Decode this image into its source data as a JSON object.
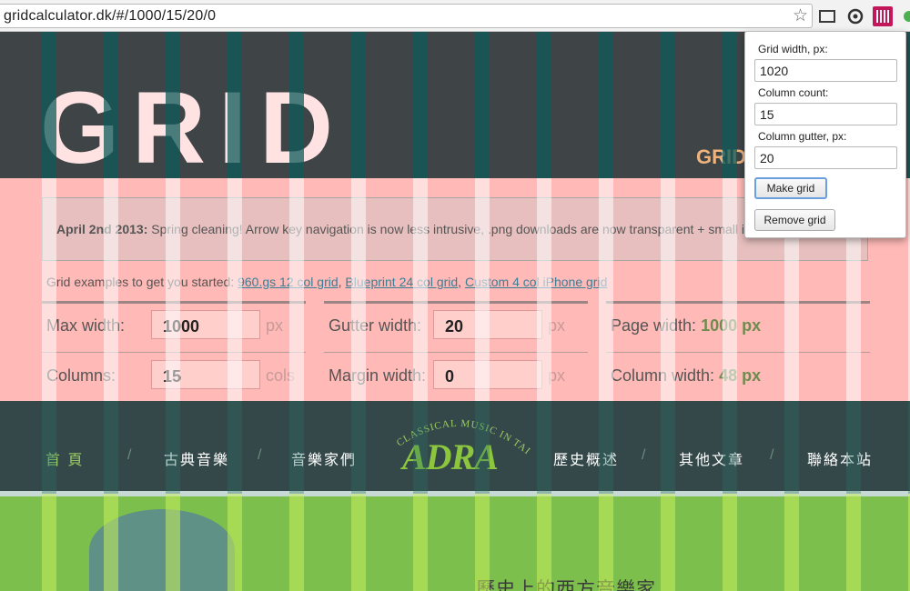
{
  "browser": {
    "url": "gridcalculator.dk/#/1000/15/20/0",
    "star_icon": "star-icon",
    "extension_icons": [
      "screenshot-icon",
      "sync-icon",
      "grid-extension-icon",
      "puzzle-icon"
    ]
  },
  "site": {
    "title": "GRID",
    "subtitle": "GRID",
    "notice_date": "April 2nd 2013:",
    "notice_text": " Spring cleaning! Arrow key navigation is now less intrusive, .png downloads are now transparent + small i",
    "examples_prefix": "Grid examples to get you started: ",
    "examples": [
      "960.gs 12 col grid",
      "Blueprint 24 col grid",
      "Custom 4 col iPhone grid"
    ],
    "fields": {
      "max_width_label": "Max width:",
      "max_width_value": "1000",
      "max_width_unit": "px",
      "columns_label": "Columns:",
      "columns_value": "15",
      "columns_unit": "cols",
      "gutter_label": "Gutter width:",
      "gutter_value": "20",
      "gutter_unit": "px",
      "margin_label": "Margin width:",
      "margin_value": "0",
      "margin_unit": "px",
      "page_width_label": "Page width: ",
      "page_width_value": "1000 px",
      "column_width_label": "Column width: ",
      "column_width_value": "48 px"
    }
  },
  "nav": {
    "items": [
      "首 頁",
      "古典音樂",
      "音樂家們",
      "歷史概述",
      "其他文章",
      "聯絡本站"
    ],
    "separator": "/",
    "logo_arc": "CLASSICAL MUSIC IN TAIWAN",
    "logo": "ADRA"
  },
  "main": {
    "headline": "歷史上的西方音樂家"
  },
  "popup": {
    "grid_width_label": "Grid width, px:",
    "grid_width_value": "1020",
    "column_count_label": "Column count:",
    "column_count_value": "15",
    "column_gutter_label": "Column gutter, px:",
    "column_gutter_value": "20",
    "make_grid": "Make grid",
    "remove_grid": "Remove grid"
  },
  "colors": {
    "header_bg": "#3f4446",
    "content_bg": "#ffb9b6",
    "nav_bg": "#34484a",
    "green_bg": "#7cbf4d",
    "accent_green": "#6f8b4f",
    "grid_overlay_header": "#0e5a5a",
    "grid_overlay_content": "#ffffff"
  }
}
